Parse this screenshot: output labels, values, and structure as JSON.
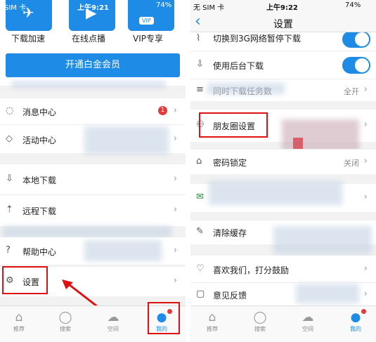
{
  "left": {
    "status": {
      "carrier": "SIM 卡",
      "time": "上午9:21",
      "battery": "74%"
    },
    "top_icons": [
      {
        "label": "下载加速",
        "icon": "rocket-icon"
      },
      {
        "label": "在线点播",
        "icon": "tv-icon"
      },
      {
        "label": "VIP专享",
        "icon": "vip-icon",
        "badge": "VIP"
      }
    ],
    "upgrade_button": "开通白金会员",
    "menu": [
      {
        "label": "消息中心",
        "icon": "message-icon",
        "badge": "1"
      },
      {
        "label": "活动中心",
        "icon": "tag-icon"
      },
      {
        "label": "本地下载",
        "icon": "download-icon"
      },
      {
        "label": "远程下载",
        "icon": "remote-icon"
      },
      {
        "label": "帮助中心",
        "icon": "help-icon"
      },
      {
        "label": "设置",
        "icon": "gear-icon"
      }
    ],
    "tabs": [
      {
        "label": "推荐",
        "icon": "home-icon"
      },
      {
        "label": "搜索",
        "icon": "search-icon"
      },
      {
        "label": "空间",
        "icon": "cloud-icon"
      },
      {
        "label": "我的",
        "icon": "user-icon",
        "active": true
      }
    ]
  },
  "right": {
    "status": {
      "carrier": "无 SIM 卡",
      "time": "上午9:22",
      "battery": "74%"
    },
    "title": "设置",
    "rows": [
      {
        "label": "切换到3G网络暂停下载",
        "icon": "network-icon",
        "toggle": true
      },
      {
        "label": "使用后台下载",
        "icon": "background-download-icon",
        "toggle": true
      },
      {
        "label": "同时下载任务数",
        "icon": "task-icon",
        "value": "全开"
      },
      {
        "label": "朋友圈设置",
        "icon": "friends-icon"
      },
      {
        "label": "密码锁定",
        "icon": "lock-icon",
        "value": "关闭"
      },
      {
        "label": "",
        "icon": "mail-icon"
      },
      {
        "label": "清除缓存",
        "icon": "brush-icon"
      },
      {
        "label": "喜欢我们，打分鼓励",
        "icon": "heart-icon"
      },
      {
        "label": "意见反馈",
        "icon": "feedback-icon"
      }
    ],
    "tabs": [
      {
        "label": "推荐",
        "icon": "home-icon"
      },
      {
        "label": "搜索",
        "icon": "search-icon"
      },
      {
        "label": "空间",
        "icon": "cloud-icon"
      },
      {
        "label": "我的",
        "icon": "user-icon",
        "active": true
      }
    ]
  },
  "colors": {
    "accent": "#1e8ce6",
    "highlight": "#d11111",
    "badge": "#e33b3b"
  }
}
